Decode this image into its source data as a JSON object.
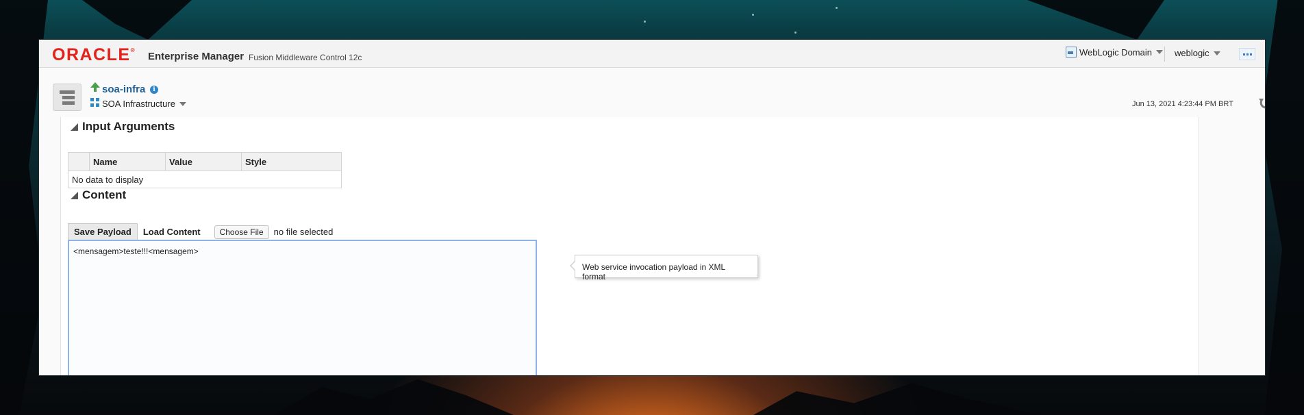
{
  "header": {
    "logo_text": "ORACLE",
    "product": "Enterprise Manager",
    "subtitle": "Fusion Middleware Control 12c",
    "domain_menu_label": "WebLogic Domain",
    "user_menu_label": "weblogic"
  },
  "target": {
    "name": "soa-infra",
    "info_icon": "i",
    "type_label": "SOA Infrastructure",
    "timestamp": "Jun 13, 2021 4:23:44 PM BRT"
  },
  "input_arguments": {
    "title": "Input Arguments",
    "columns": [
      "",
      "Name",
      "Value",
      "Style"
    ],
    "empty_text": "No data to display"
  },
  "content": {
    "title": "Content",
    "tabs": [
      "Save Payload",
      "Load Content"
    ],
    "active_tab": "Save Payload",
    "file_button": "Choose File",
    "file_status": "no file selected",
    "payload": "<mensagem>teste!!!<mensagem>",
    "tooltip": "Web service invocation payload in XML format"
  },
  "icons": {
    "nav_toggle": "menu-icon",
    "target_status": "up-arrow-icon",
    "target_type": "soa-icon",
    "domain": "weblogic-domain-icon",
    "refresh": "refresh-icon",
    "more": "more-icon"
  },
  "colors": {
    "oracle_red": "#e3231b",
    "link_blue": "#1f5f94",
    "focus_border": "#8fb3e6"
  }
}
